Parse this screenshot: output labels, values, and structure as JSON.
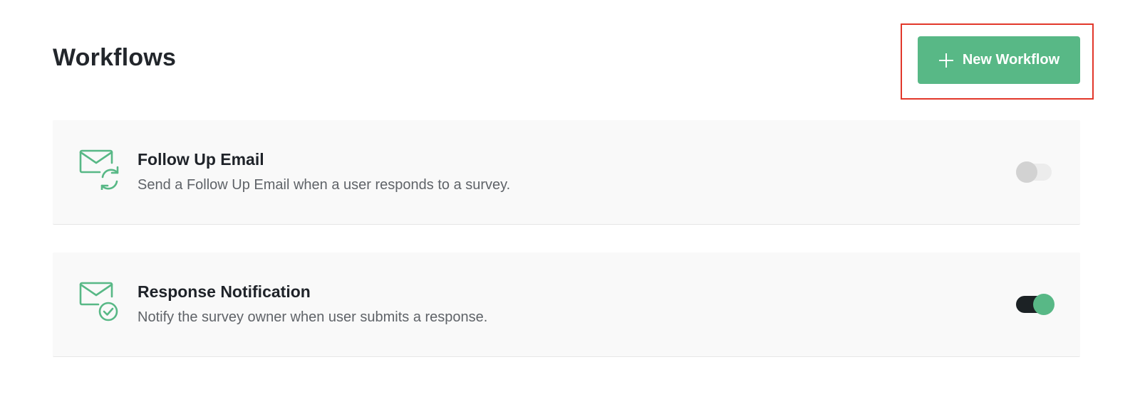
{
  "header": {
    "title": "Workflows",
    "new_button_label": "New Workflow"
  },
  "workflows": [
    {
      "title": "Follow Up Email",
      "description": "Send a Follow Up Email when a user responds to a survey.",
      "icon": "mail-sync-icon",
      "enabled": false
    },
    {
      "title": "Response Notification",
      "description": "Notify the survey owner when user submits a response.",
      "icon": "mail-check-icon",
      "enabled": true
    }
  ],
  "colors": {
    "accent": "#58b886",
    "highlight": "#e2372a",
    "toggle_on_track": "#1c2225",
    "toggle_off_knob": "#d2d2d2",
    "card_bg": "#f9f9f9"
  }
}
